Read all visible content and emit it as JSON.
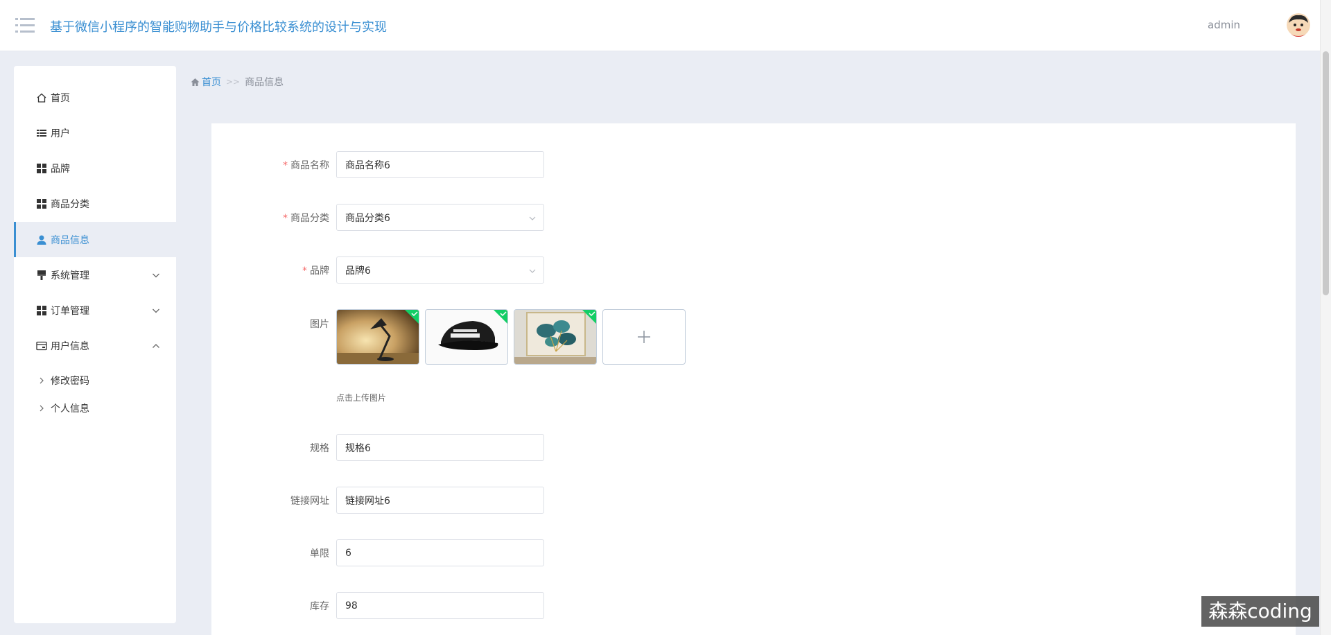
{
  "header": {
    "title": "基于微信小程序的智能购物助手与价格比较系统的设计与实现",
    "user_name": "admin"
  },
  "sidebar": {
    "items": [
      {
        "label": "首页",
        "icon": "home-icon"
      },
      {
        "label": "用户",
        "icon": "list-icon"
      },
      {
        "label": "品牌",
        "icon": "grid-icon"
      },
      {
        "label": "商品分类",
        "icon": "grid-icon"
      },
      {
        "label": "商品信息",
        "icon": "user-icon",
        "active": true
      },
      {
        "label": "系统管理",
        "icon": "brush-icon",
        "expandable": true
      },
      {
        "label": "订单管理",
        "icon": "grid-icon",
        "expandable": true
      },
      {
        "label": "用户信息",
        "icon": "card-icon",
        "expanded": true
      }
    ],
    "subitems": [
      {
        "label": "修改密码"
      },
      {
        "label": "个人信息"
      }
    ]
  },
  "breadcrumb": {
    "home": "首页",
    "separator": ">>",
    "current": "商品信息"
  },
  "form": {
    "name": {
      "label": "商品名称",
      "required": true,
      "value": "商品名称6"
    },
    "category": {
      "label": "商品分类",
      "required": true,
      "value": "商品分类6"
    },
    "brand": {
      "label": "品牌",
      "required": true,
      "value": "品牌6"
    },
    "images": {
      "label": "图片",
      "tip": "点击上传图片",
      "count": 3
    },
    "spec": {
      "label": "规格",
      "value": "规格6"
    },
    "link": {
      "label": "链接网址",
      "value": "链接网址6"
    },
    "limit": {
      "label": "单限",
      "value": "6"
    },
    "stock": {
      "label": "库存",
      "value": "98"
    }
  },
  "watermark": "森森coding",
  "colors": {
    "accent": "#3a8fd2",
    "background": "#eaedf4",
    "required": "#f56c6c",
    "upload_success": "#13ce66"
  }
}
